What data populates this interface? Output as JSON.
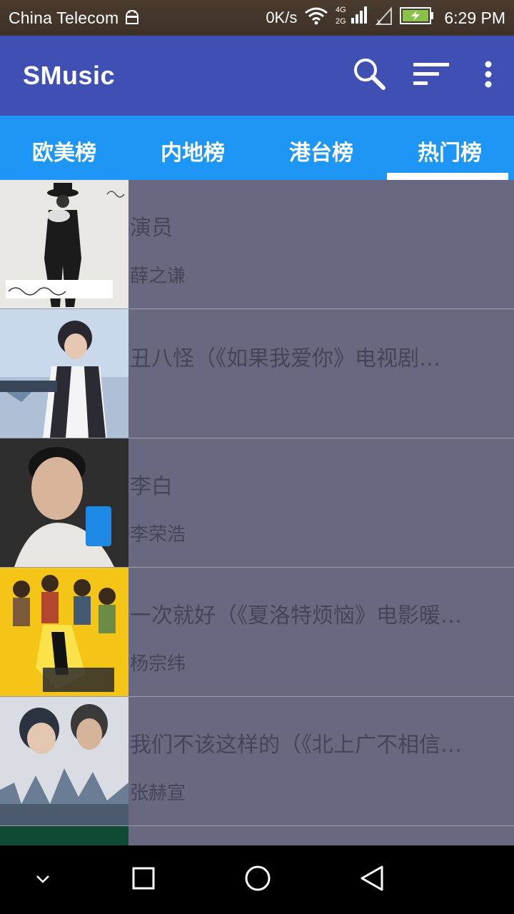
{
  "status_bar": {
    "carrier": "China Telecom",
    "net_speed": "0K/s",
    "network_labels": [
      "4G",
      "2G"
    ],
    "time": "6:29 PM",
    "icons": [
      "android-icon",
      "wifi-icon",
      "signal-icon",
      "no-sim-signal-icon",
      "battery-charging-icon"
    ]
  },
  "app_bar": {
    "title": "SMusic",
    "actions": [
      "search-icon",
      "sort-icon",
      "more-vert-icon"
    ]
  },
  "tabs": {
    "items": [
      {
        "label": "欧美榜"
      },
      {
        "label": "内地榜"
      },
      {
        "label": "港台榜"
      },
      {
        "label": "热门榜"
      }
    ],
    "selected": "热门榜"
  },
  "songs": [
    {
      "title": "演员",
      "artist": "薛之谦"
    },
    {
      "title": "丑八怪（《如果我爱你》电视剧…",
      "artist": ""
    },
    {
      "title": "李白",
      "artist": "李荣浩"
    },
    {
      "title": "一次就好（《夏洛特烦恼》电影暖…",
      "artist": "杨宗纬"
    },
    {
      "title": "我们不该这样的（《北上广不相信…",
      "artist": "张赫宣"
    }
  ],
  "nav_bar": {
    "buttons": [
      "hide-keyboard-icon",
      "recents-icon",
      "home-icon",
      "back-icon"
    ]
  },
  "colors": {
    "status_bar": "#4a3b2e",
    "app_bar": "#3f4fb4",
    "tab_bar": "#1e96f5",
    "list_bg": "#686880",
    "text": "#45455a"
  }
}
